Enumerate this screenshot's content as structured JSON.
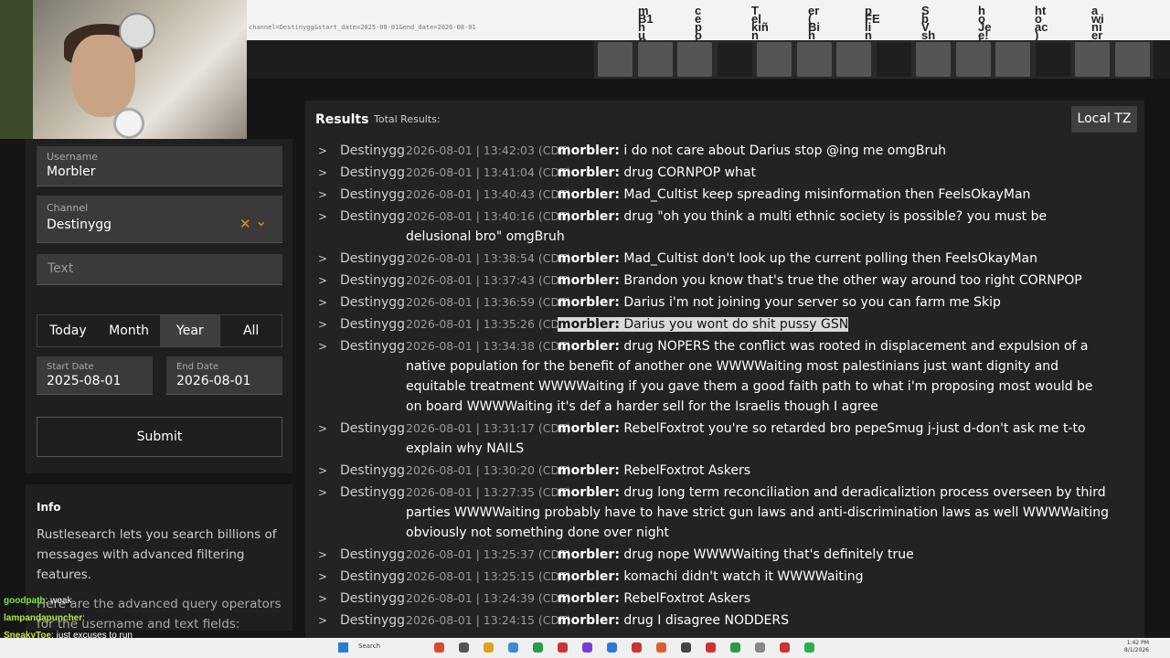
{
  "browser": {
    "url": "channel=Destinygg&start_date=2025-08-01&end_date=2026-08-01",
    "top_glyphs": [
      "m",
      "c",
      "T",
      "er",
      "p",
      "S",
      "h",
      "ht",
      "a",
      "B1",
      "e",
      "el",
      "(",
      "FE",
      "b",
      "o",
      "o",
      "wi",
      "h",
      "p",
      "kiñ",
      "Bi",
      "li",
      "V",
      "Je",
      "ac",
      "ni",
      "u",
      "o",
      "n",
      "h",
      "n",
      "sh",
      "e!",
      ")",
      "er",
      "ff",
      "h",
      "s",
      "p",
      "n",
      "g",
      "h"
    ]
  },
  "search_form": {
    "username_label": "Username",
    "username_value": "Morbler",
    "channel_label": "Channel",
    "channel_value": "Destinygg",
    "clear_glyph": "✕",
    "chevron_glyph": "⌄",
    "text_placeholder": "Text",
    "periods": [
      "Today",
      "Month",
      "Year",
      "All"
    ],
    "active_period": "Year",
    "start_date_label": "Start Date",
    "start_date_value": "2025-08-01",
    "end_date_label": "End Date",
    "end_date_value": "2026-08-01",
    "submit_label": "Submit"
  },
  "info": {
    "title": "Info",
    "paragraph_1": "Rustlesearch lets you search billions of messages with advanced filtering features.",
    "paragraph_2": "Here are the advanced query operators for the username and text fields:"
  },
  "chat_overlay": [
    {
      "name": "goodpath",
      "message": ": weak"
    },
    {
      "name": "lampandapuncher",
      "message": ":"
    },
    {
      "name": "SneakyToe",
      "message": ": just excuses to run"
    }
  ],
  "results": {
    "title": "Results",
    "total_label": "Total Results:",
    "tz_button": "Local TZ",
    "caret": ">",
    "rows": [
      {
        "channel": "Destinygg",
        "ts": "2026-08-01 | 13:42:03 (CDT)",
        "user": "morbler:",
        "text": "i do not care about Darius stop @ing me omgBruh",
        "lines": 1
      },
      {
        "channel": "Destinygg",
        "ts": "2026-08-01 | 13:41:04 (CDT)",
        "user": "morbler:",
        "text": "drug CORNPOP what",
        "lines": 1
      },
      {
        "channel": "Destinygg",
        "ts": "2026-08-01 | 13:40:43 (CDT)",
        "user": "morbler:",
        "text": "Mad_Cultist keep spreading misinformation then FeelsOkayMan",
        "lines": 1
      },
      {
        "channel": "Destinygg",
        "ts": "2026-08-01 | 13:40:16 (CDT)",
        "user": "morbler:",
        "text": "drug \"oh you think a multi ethnic society is possible? you must be delusional bro\" omgBruh",
        "lines": 2
      },
      {
        "channel": "Destinygg",
        "ts": "2026-08-01 | 13:38:54 (CDT)",
        "user": "morbler:",
        "text": "Mad_Cultist don't look up the current polling then FeelsOkayMan",
        "lines": 1
      },
      {
        "channel": "Destinygg",
        "ts": "2026-08-01 | 13:37:43 (CDT)",
        "user": "morbler:",
        "text": "Brandon you know that's true the other way around too right CORNPOP",
        "lines": 1
      },
      {
        "channel": "Destinygg",
        "ts": "2026-08-01 | 13:36:59 (CDT)",
        "user": "morbler:",
        "text": "Darius i'm not joining your server so you can farm me Skip",
        "lines": 1
      },
      {
        "channel": "Destinygg",
        "ts": "2026-08-01 | 13:35:26 (CDT)",
        "user": "morbler:",
        "text": "Darius you wont do shit pussy GSN",
        "lines": 1,
        "highlight": true
      },
      {
        "channel": "Destinygg",
        "ts": "2026-08-01 | 13:34:38 (CDT)",
        "user": "morbler:",
        "text": "drug NOPERS the conflict was rooted in displacement and expulsion of a native population for the benefit of another one WWWWaiting most palestinians just want dignity and equitable treatment WWWWaiting if you gave them a good faith path to what i'm proposing most would be on board WWWWaiting it's def a harder sell for the Israelis though I agree",
        "lines": 4
      },
      {
        "channel": "Destinygg",
        "ts": "2026-08-01 | 13:31:17 (CDT)",
        "user": "morbler:",
        "text": "RebelFoxtrot you're so retarded bro pepeSmug j-just d-don't ask me t-to explain why NAILS",
        "lines": 2
      },
      {
        "channel": "Destinygg",
        "ts": "2026-08-01 | 13:30:20 (CDT)",
        "user": "morbler:",
        "text": "RebelFoxtrot Askers",
        "lines": 1
      },
      {
        "channel": "Destinygg",
        "ts": "2026-08-01 | 13:27:35 (CDT)",
        "user": "morbler:",
        "text": "drug long term reconciliation and deradicaliztion process overseen by third parties WWWWaiting probably have to have strict gun laws and anti-discrimination laws as well WWWWaiting obviously not something done over night",
        "lines": 3
      },
      {
        "channel": "Destinygg",
        "ts": "2026-08-01 | 13:25:37 (CDT)",
        "user": "morbler:",
        "text": "drug nope WWWWaiting that's definitely true",
        "lines": 1
      },
      {
        "channel": "Destinygg",
        "ts": "2026-08-01 | 13:25:15 (CDT)",
        "user": "morbler:",
        "text": "komachi didn't watch it WWWWaiting",
        "lines": 1
      },
      {
        "channel": "Destinygg",
        "ts": "2026-08-01 | 13:24:39 (CDT)",
        "user": "morbler:",
        "text": "RebelFoxtrot Askers",
        "lines": 1
      },
      {
        "channel": "Destinygg",
        "ts": "2026-08-01 | 13:24:15 (CDT)",
        "user": "morbler:",
        "text": "drug I disagree NODDERS",
        "lines": 1
      }
    ]
  },
  "taskbar": {
    "search_label": "Search",
    "clock_time": "1:42 PM",
    "clock_date": "8/1/2026"
  },
  "colors": {
    "accent_orange": "#e0902a",
    "panel_bg": "#1f1f1f",
    "results_bg": "#232323"
  }
}
